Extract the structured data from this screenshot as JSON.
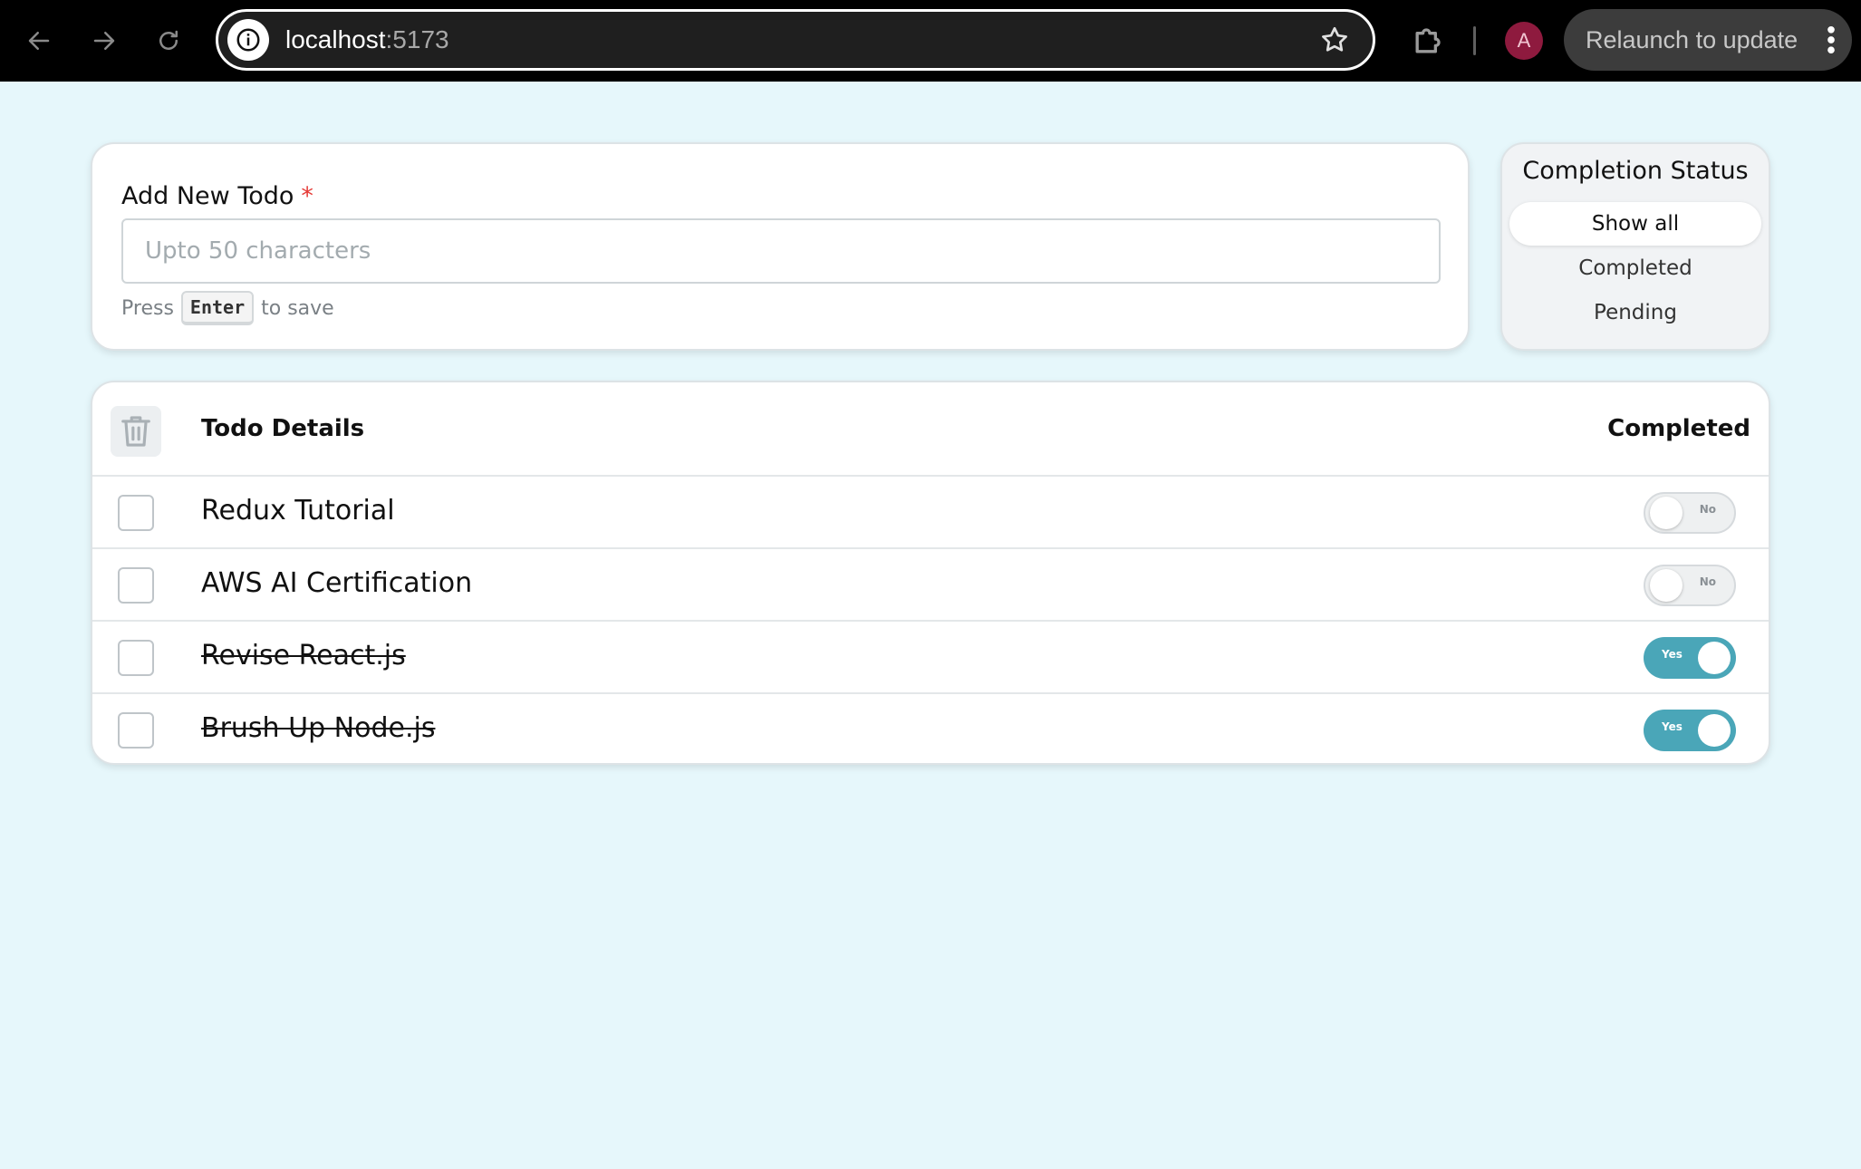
{
  "browser": {
    "url_host": "localhost",
    "url_port": ":5173",
    "avatar_initial": "A",
    "relaunch_label": "Relaunch to update"
  },
  "add_todo": {
    "label": "Add New Todo",
    "required_mark": "*",
    "placeholder": "Upto 50 characters",
    "hint_prefix": "Press",
    "hint_key": "Enter",
    "hint_suffix": "to save"
  },
  "status_filter": {
    "title": "Completion Status",
    "options": [
      {
        "label": "Show all",
        "active": true
      },
      {
        "label": "Completed",
        "active": false
      },
      {
        "label": "Pending",
        "active": false
      }
    ]
  },
  "todo_table": {
    "col_details": "Todo Details",
    "col_completed": "Completed",
    "rows": [
      {
        "title": "Redux Tutorial",
        "completed": false,
        "toggle_label": "No"
      },
      {
        "title": "AWS AI Certification",
        "completed": false,
        "toggle_label": "No"
      },
      {
        "title": "Revise React.js",
        "completed": true,
        "toggle_label": "Yes"
      },
      {
        "title": "Brush Up Node.js",
        "completed": true,
        "toggle_label": "Yes"
      }
    ]
  },
  "colors": {
    "page_bg": "#e6f7fb",
    "toggle_on": "#4aa6b8",
    "required": "#e53935",
    "avatar_bg": "#8e1a3e"
  }
}
